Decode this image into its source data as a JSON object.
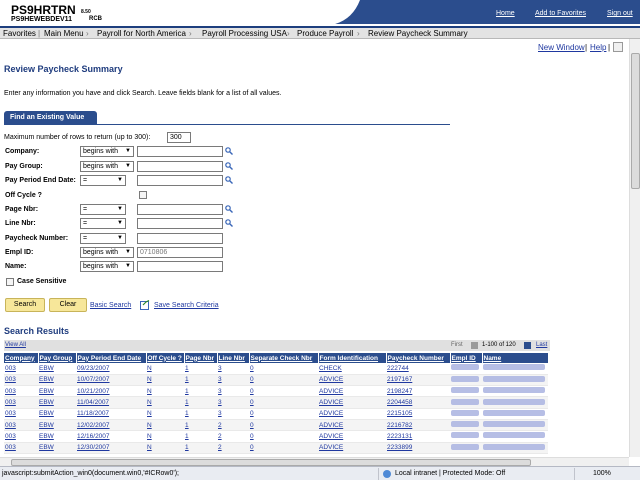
{
  "header": {
    "database": "PS9HRTRN",
    "version": "8.50",
    "server": "PS9HEWEBDEV11",
    "user": "RCB",
    "links": {
      "home": "Home",
      "favorites": "Add to Favorites",
      "signout": "Sign out"
    }
  },
  "breadcrumb": [
    "Favorites",
    "Main Menu",
    "Payroll for North America",
    "Payroll Processing USA",
    "Produce Payroll",
    "Review Paycheck Summary"
  ],
  "page_links": {
    "new_window": "New Window",
    "help": "Help",
    "sep": "|"
  },
  "page_title": "Review Paycheck Summary",
  "instructions": "Enter any information you have and click Search. Leave fields blank for a list of all values.",
  "tab_label": "Find an Existing Value",
  "max_rows": {
    "label": "Maximum number of rows to return (up to 300):",
    "value": "300"
  },
  "fields": [
    {
      "label": "Company:",
      "operator": "begins with"
    },
    {
      "label": "Pay Group:",
      "operator": "begins with"
    },
    {
      "label": "Pay Period End Date:",
      "operator": "="
    },
    {
      "label": "Off Cycle ?"
    },
    {
      "label": "Page Nbr:",
      "operator": "="
    },
    {
      "label": "Line Nbr:",
      "operator": "="
    },
    {
      "label": "Paycheck Number:",
      "operator": "="
    },
    {
      "label": "Empl ID:",
      "operator": "begins with",
      "value": "0710806"
    },
    {
      "label": "Name:",
      "operator": "begins with"
    }
  ],
  "case_sensitive": "Case Sensitive",
  "buttons": {
    "search": "Search",
    "clear": "Clear",
    "basic_search": "Basic Search",
    "save_criteria": "Save Search Criteria"
  },
  "results": {
    "title": "Search Results",
    "view_all": "View All",
    "first": "First",
    "range": "1-100 of 120",
    "last": "Last",
    "columns": [
      "Company",
      "Pay Group",
      "Pay Period End Date",
      "Off Cycle ?",
      "Page Nbr",
      "Line Nbr",
      "Separate Check Nbr",
      "Form Identification",
      "Paycheck Number",
      "Empl ID",
      "Name"
    ],
    "rows": [
      [
        "003",
        "EBW",
        "09/23/2007",
        "N",
        "1",
        "3",
        "0",
        "CHECK",
        "222744"
      ],
      [
        "003",
        "EBW",
        "10/07/2007",
        "N",
        "1",
        "3",
        "0",
        "ADVICE",
        "2197167"
      ],
      [
        "003",
        "EBW",
        "10/21/2007",
        "N",
        "1",
        "3",
        "0",
        "ADVICE",
        "2198247"
      ],
      [
        "003",
        "EBW",
        "11/04/2007",
        "N",
        "1",
        "3",
        "0",
        "ADVICE",
        "2204458"
      ],
      [
        "003",
        "EBW",
        "11/18/2007",
        "N",
        "1",
        "3",
        "0",
        "ADVICE",
        "2215105"
      ],
      [
        "003",
        "EBW",
        "12/02/2007",
        "N",
        "1",
        "2",
        "0",
        "ADVICE",
        "2216782"
      ],
      [
        "003",
        "EBW",
        "12/16/2007",
        "N",
        "1",
        "2",
        "0",
        "ADVICE",
        "2223131"
      ],
      [
        "003",
        "EBW",
        "12/30/2007",
        "N",
        "1",
        "2",
        "0",
        "ADVICE",
        "2233899"
      ]
    ]
  },
  "status_bar": {
    "text": "javascript:submitAction_win0(document.win0,'#ICRow0');",
    "zone": "Local intranet | Protected Mode: Off",
    "zoom": "100%"
  },
  "colors": {
    "accent": "#2b4d8d",
    "title": "#1f3c7e",
    "button": "#f7e79a"
  }
}
